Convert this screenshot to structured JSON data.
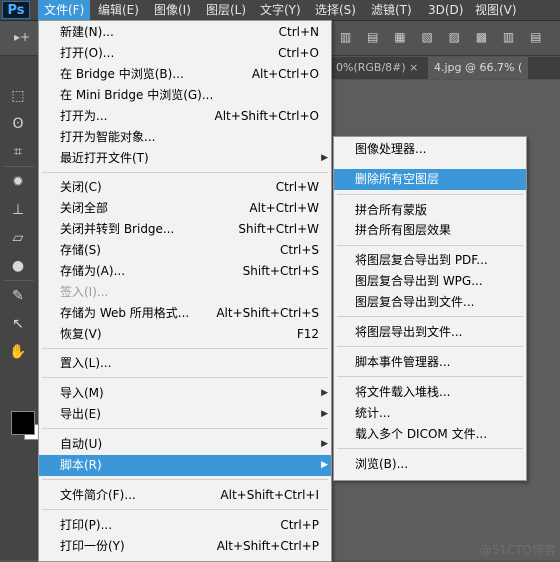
{
  "app": {
    "logo": "Ps"
  },
  "menubar": [
    {
      "label": "文件(F)",
      "active": true
    },
    {
      "label": "编辑(E)"
    },
    {
      "label": "图像(I)"
    },
    {
      "label": "图层(L)"
    },
    {
      "label": "文字(Y)"
    },
    {
      "label": "选择(S)"
    },
    {
      "label": "滤镜(T)"
    },
    {
      "label": "3D(D)"
    },
    {
      "label": "视图(V)"
    }
  ],
  "tabs": [
    {
      "label": "0%(RGB/8#)",
      "close": "×"
    },
    {
      "label": "4.jpg @ 66.7% (",
      "active": true
    }
  ],
  "file_menu": {
    "items": [
      {
        "label": "新建(N)...",
        "shortcut": "Ctrl+N"
      },
      {
        "label": "打开(O)...",
        "shortcut": "Ctrl+O"
      },
      {
        "label": "在 Bridge 中浏览(B)...",
        "shortcut": "Alt+Ctrl+O"
      },
      {
        "label": "在 Mini Bridge 中浏览(G)...",
        "shortcut": ""
      },
      {
        "label": "打开为...",
        "shortcut": "Alt+Shift+Ctrl+O"
      },
      {
        "label": "打开为智能对象...",
        "shortcut": ""
      },
      {
        "label": "最近打开文件(T)",
        "shortcut": "",
        "submenu": true
      },
      {
        "label": "关闭(C)",
        "shortcut": "Ctrl+W"
      },
      {
        "label": "关闭全部",
        "shortcut": "Alt+Ctrl+W"
      },
      {
        "label": "关闭并转到 Bridge...",
        "shortcut": "Shift+Ctrl+W"
      },
      {
        "label": "存储(S)",
        "shortcut": "Ctrl+S"
      },
      {
        "label": "存储为(A)...",
        "shortcut": "Shift+Ctrl+S"
      },
      {
        "label": "签入(I)...",
        "shortcut": "",
        "disabled": true
      },
      {
        "label": "存储为 Web 所用格式...",
        "shortcut": "Alt+Shift+Ctrl+S"
      },
      {
        "label": "恢复(V)",
        "shortcut": "F12"
      },
      {
        "label": "置入(L)...",
        "shortcut": ""
      },
      {
        "label": "导入(M)",
        "shortcut": "",
        "submenu": true
      },
      {
        "label": "导出(E)",
        "shortcut": "",
        "submenu": true
      },
      {
        "label": "自动(U)",
        "shortcut": "",
        "submenu": true
      },
      {
        "label": "脚本(R)",
        "shortcut": "",
        "submenu": true,
        "highlighted": true
      },
      {
        "label": "文件简介(F)...",
        "shortcut": "Alt+Shift+Ctrl+I"
      },
      {
        "label": "打印(P)...",
        "shortcut": "Ctrl+P"
      },
      {
        "label": "打印一份(Y)",
        "shortcut": "Alt+Shift+Ctrl+P"
      }
    ]
  },
  "script_menu": {
    "items": [
      {
        "label": "图像处理器..."
      },
      {
        "label": "删除所有空图层",
        "highlighted": true
      },
      {
        "label": "拼合所有蒙版"
      },
      {
        "label": "拼合所有图层效果"
      },
      {
        "label": "将图层复合导出到 PDF..."
      },
      {
        "label": "图层复合导出到 WPG..."
      },
      {
        "label": "图层复合导出到文件..."
      },
      {
        "label": "将图层导出到文件..."
      },
      {
        "label": "脚本事件管理器..."
      },
      {
        "label": "将文件载入堆栈..."
      },
      {
        "label": "统计..."
      },
      {
        "label": "载入多个 DICOM 文件..."
      },
      {
        "label": "浏览(B)..."
      }
    ]
  },
  "submenu_arrow": "▶",
  "watermark": "@51CTO博客",
  "colors": {
    "highlight": "#3b97d8",
    "menu_bg": "#f2f2f2"
  }
}
